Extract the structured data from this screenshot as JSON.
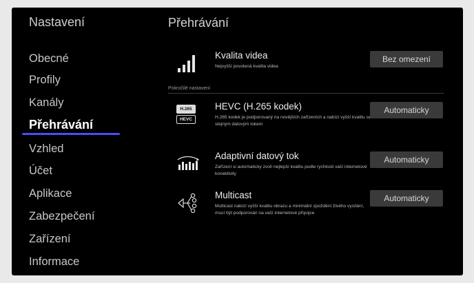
{
  "sidebar": {
    "title": "Nastavení",
    "items": [
      {
        "label": "Obecné"
      },
      {
        "label": "Profily"
      },
      {
        "label": "Kanály"
      },
      {
        "label": "Přehrávání"
      },
      {
        "label": "Vzhled"
      },
      {
        "label": "Účet"
      },
      {
        "label": "Aplikace"
      },
      {
        "label": "Zabezpečení"
      },
      {
        "label": "Zařízení"
      },
      {
        "label": "Informace"
      }
    ],
    "active_item": "Přehrávání",
    "accent_color": "#4c4cff"
  },
  "content": {
    "title": "Přehrávání",
    "video_quality": {
      "icon": "signal-bars-icon",
      "title": "Kvalita videa",
      "description": "Nejvyšší povolená kvalita videa",
      "button": "Bez omezení"
    },
    "advanced_label": "Pokročilé nastavení",
    "hevc": {
      "icon": "hevc-codec-icon",
      "badge_top": "H.265",
      "badge_bottom": "HEVC",
      "title": "HEVC (H.265 kodek)",
      "description": "H.265 kodek je podporovaný na novějších zařízeních a nabízí vyšší kvalitu se stejným datovým tokem",
      "button": "Automaticky"
    },
    "adaptive": {
      "icon": "adaptive-bitrate-icon",
      "title": "Adaptivní datový tok",
      "description": "Zařízení si automaticky zvolí nejlepší kvalitu podle rychlosti vaší internetové konektivity",
      "button": "Automaticky"
    },
    "multicast": {
      "icon": "multicast-icon",
      "title": "Multicast",
      "description": "Multicast nabízí vyšší kvalitu obrazu a minimální zpoždění živého vysílání, musí být podporován na vaší internetové přípojce",
      "button": "Automaticky"
    }
  }
}
